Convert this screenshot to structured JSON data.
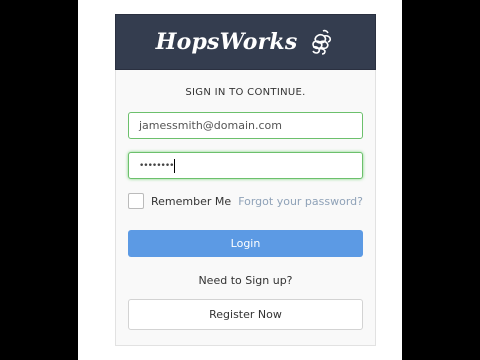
{
  "app": {
    "brand": "HopsWorks",
    "logo_icon": "hop-cone-icon"
  },
  "login": {
    "subtitle": "SIGN IN TO CONTINUE.",
    "email_value": "jamessmith@domain.com",
    "password_mask": "••••••••",
    "remember_label": "Remember Me",
    "remember_checked": false,
    "forgot_link": "Forgot your password?",
    "login_button": "Login",
    "signup_prompt": "Need to Sign up?",
    "register_button": "Register Now"
  },
  "colors": {
    "header_bg": "#343d4f",
    "login_button": "#5c9ae4",
    "field_focus_border": "#6cc06c",
    "link": "#8fa2b8"
  }
}
